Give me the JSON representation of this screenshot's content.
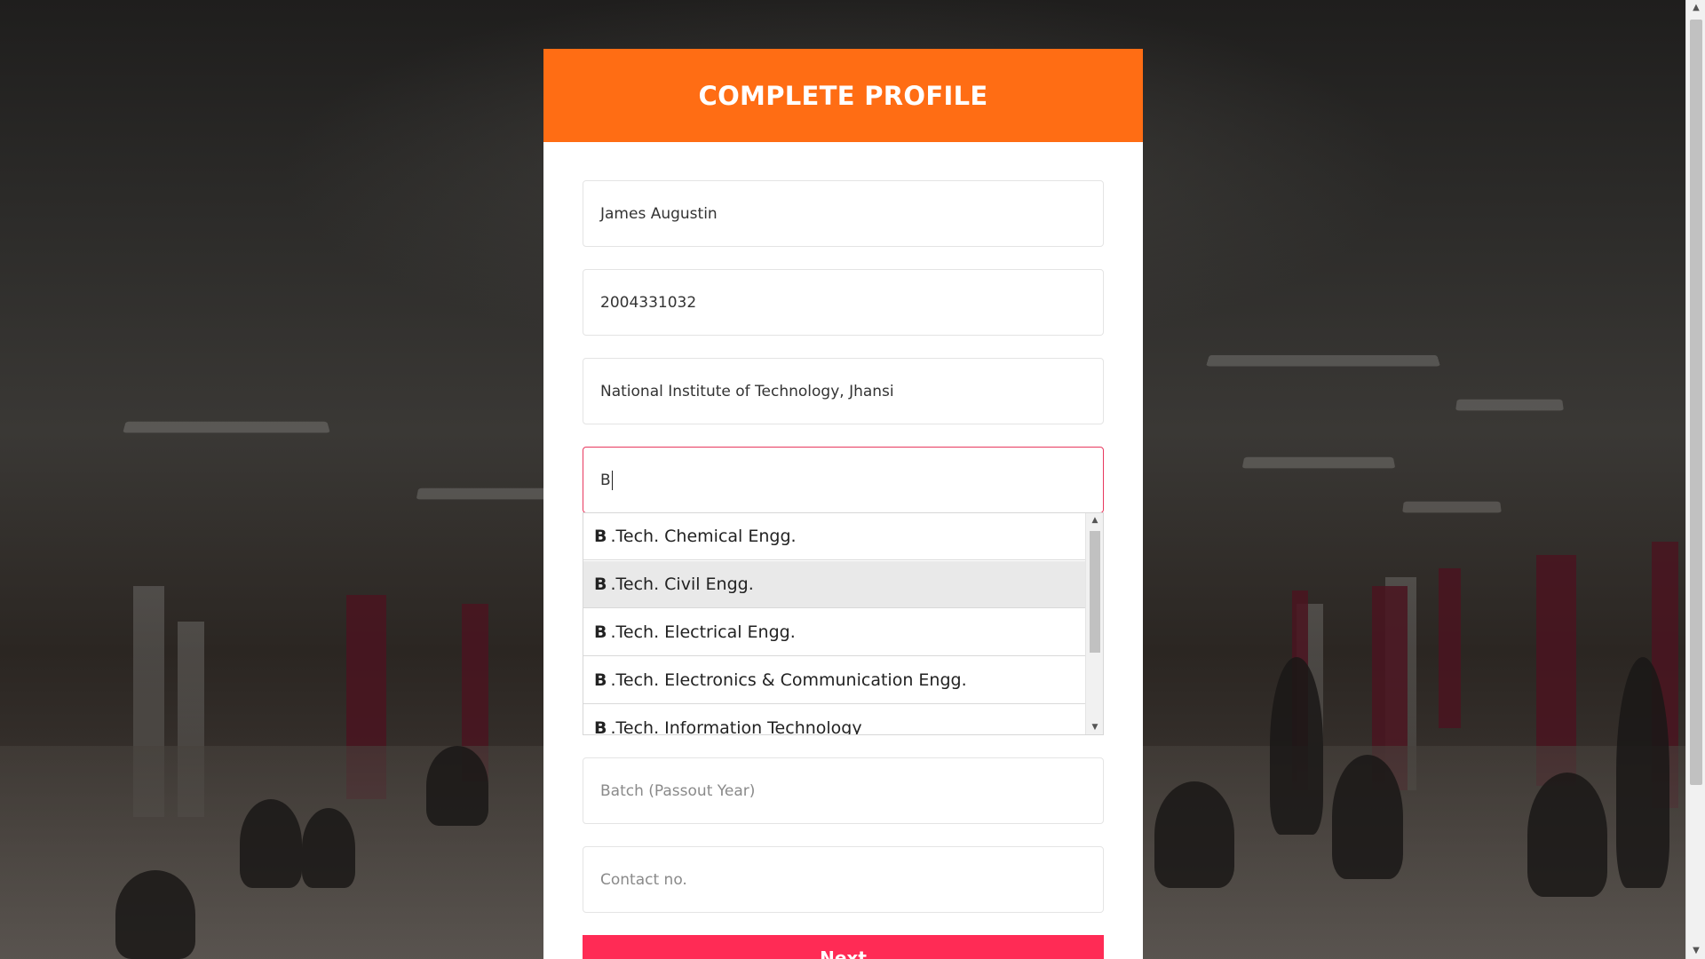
{
  "header": {
    "title": "COMPLETE PROFILE"
  },
  "form": {
    "name_value": "James Augustin",
    "roll_value": "2004331032",
    "institute_value": "National Institute of Technology, Jhansi",
    "course_value": "B",
    "batch_placeholder": "Batch (Passout Year)",
    "contact_placeholder": "Contact no.",
    "submit_label": "Next"
  },
  "autocomplete": {
    "match_prefix": "B",
    "items": [
      {
        "prefix": "B",
        "rest": ".Tech. Chemical Engg.",
        "highlighted": false
      },
      {
        "prefix": "B",
        "rest": ".Tech. Civil Engg.",
        "highlighted": true
      },
      {
        "prefix": "B",
        "rest": ".Tech. Electrical Engg.",
        "highlighted": false
      },
      {
        "prefix": "B",
        "rest": ".Tech. Electronics & Communication Engg.",
        "highlighted": false
      },
      {
        "prefix": "B",
        "rest": ".Tech. Information Technology",
        "highlighted": false
      }
    ]
  },
  "colors": {
    "header_bg": "#ff6d14",
    "focus_border": "#e8385e",
    "submit_bg": "#ff2b55"
  },
  "icons": {
    "scroll_up": "triangle-up-icon",
    "scroll_down": "triangle-down-icon"
  }
}
